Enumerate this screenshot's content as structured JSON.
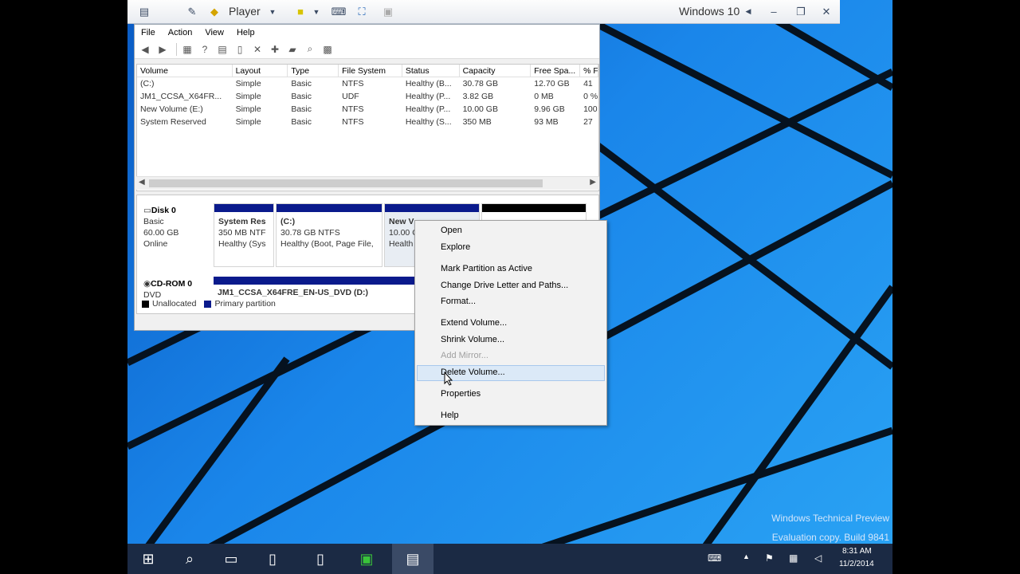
{
  "player": {
    "label": "Player",
    "vm_name": "Windows 10"
  },
  "disk_mgmt": {
    "menu": [
      "File",
      "Action",
      "View",
      "Help"
    ],
    "columns": [
      "Volume",
      "Layout",
      "Type",
      "File System",
      "Status",
      "Capacity",
      "Free Spa...",
      "% F"
    ],
    "rows": [
      [
        "(C:)",
        "Simple",
        "Basic",
        "NTFS",
        "Healthy (B...",
        "30.78 GB",
        "12.70 GB",
        "41"
      ],
      [
        "JM1_CCSA_X64FR...",
        "Simple",
        "Basic",
        "UDF",
        "Healthy (P...",
        "3.82 GB",
        "0 MB",
        "0 %"
      ],
      [
        "New Volume (E:)",
        "Simple",
        "Basic",
        "NTFS",
        "Healthy (P...",
        "10.00 GB",
        "9.96 GB",
        "100"
      ],
      [
        "System Reserved",
        "Simple",
        "Basic",
        "NTFS",
        "Healthy (S...",
        "350 MB",
        "93 MB",
        "27"
      ]
    ],
    "disk0": {
      "name": "Disk 0",
      "type": "Basic",
      "size": "60.00 GB",
      "status": "Online",
      "parts": [
        {
          "title": "System Res",
          "line1": "350 MB NTF",
          "line2": "Healthy (Sys"
        },
        {
          "title": "(C:)",
          "line1": "30.78 GB NTFS",
          "line2": "Healthy (Boot, Page File,"
        },
        {
          "title": "New V",
          "line1": "10.00 G",
          "line2": "Health"
        }
      ]
    },
    "cdrom": {
      "name": "CD-ROM 0",
      "type": "DVD",
      "part_label": "JM1_CCSA_X64FRE_EN-US_DVD (D:)"
    },
    "legend": {
      "unallocated": "Unallocated",
      "primary": "Primary partition"
    }
  },
  "context_menu": {
    "items": [
      {
        "label": "Open",
        "disabled": false
      },
      {
        "label": "Explore",
        "disabled": false
      },
      {
        "label": "Mark Partition as Active",
        "disabled": false
      },
      {
        "label": "Change Drive Letter and Paths...",
        "disabled": false
      },
      {
        "label": "Format...",
        "disabled": false
      },
      {
        "label": "Extend Volume...",
        "disabled": false
      },
      {
        "label": "Shrink Volume...",
        "disabled": false
      },
      {
        "label": "Add Mirror...",
        "disabled": true
      },
      {
        "label": "Delete Volume...",
        "disabled": false
      },
      {
        "label": "Properties",
        "disabled": false
      },
      {
        "label": "Help",
        "disabled": false
      }
    ],
    "highlighted": "Delete Volume..."
  },
  "watermark": {
    "line1": "Windows Technical Preview",
    "line2": "Evaluation copy. Build 9841"
  },
  "taskbar": {
    "time": "8:31 AM",
    "date": "11/2/2014"
  },
  "colors": {
    "primary_partition": "#0a1a8c",
    "unallocated": "#000000",
    "taskbar": "#1b2a44",
    "desktop": "#1a86ea"
  }
}
